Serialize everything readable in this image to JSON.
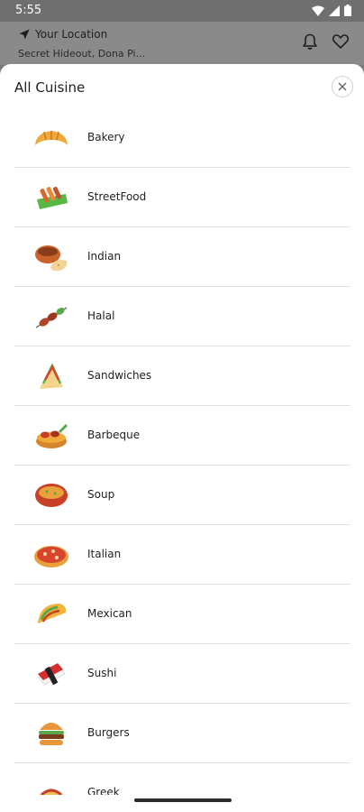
{
  "status": {
    "time": "5:55"
  },
  "header": {
    "location_title": "Your Location",
    "location_address": "Secret Hideout, Dona Pi...",
    "icons": [
      "navigation-arrow-icon",
      "bell-icon",
      "heart-icon"
    ]
  },
  "sheet": {
    "title": "All Cuisine",
    "close_icon": "close-icon"
  },
  "cuisines": [
    {
      "label": "Bakery",
      "icon": "croissant-icon"
    },
    {
      "label": "StreetFood",
      "icon": "street-food-icon"
    },
    {
      "label": "Indian",
      "icon": "curry-naan-icon"
    },
    {
      "label": "Halal",
      "icon": "kebab-skewer-icon"
    },
    {
      "label": "Sandwiches",
      "icon": "sandwich-icon"
    },
    {
      "label": "Barbeque",
      "icon": "barbeque-icon"
    },
    {
      "label": "Soup",
      "icon": "soup-bowl-icon"
    },
    {
      "label": "Italian",
      "icon": "pizza-icon"
    },
    {
      "label": "Mexican",
      "icon": "taco-icon"
    },
    {
      "label": "Sushi",
      "icon": "sushi-icon"
    },
    {
      "label": "Burgers",
      "icon": "burger-icon"
    },
    {
      "label": "Greek",
      "icon": "gyro-icon"
    }
  ],
  "colors": {
    "scrim": "#7a7a7a",
    "sheet": "#ffffff",
    "divider": "#e2e2e2",
    "text": "#1f1f1f"
  }
}
